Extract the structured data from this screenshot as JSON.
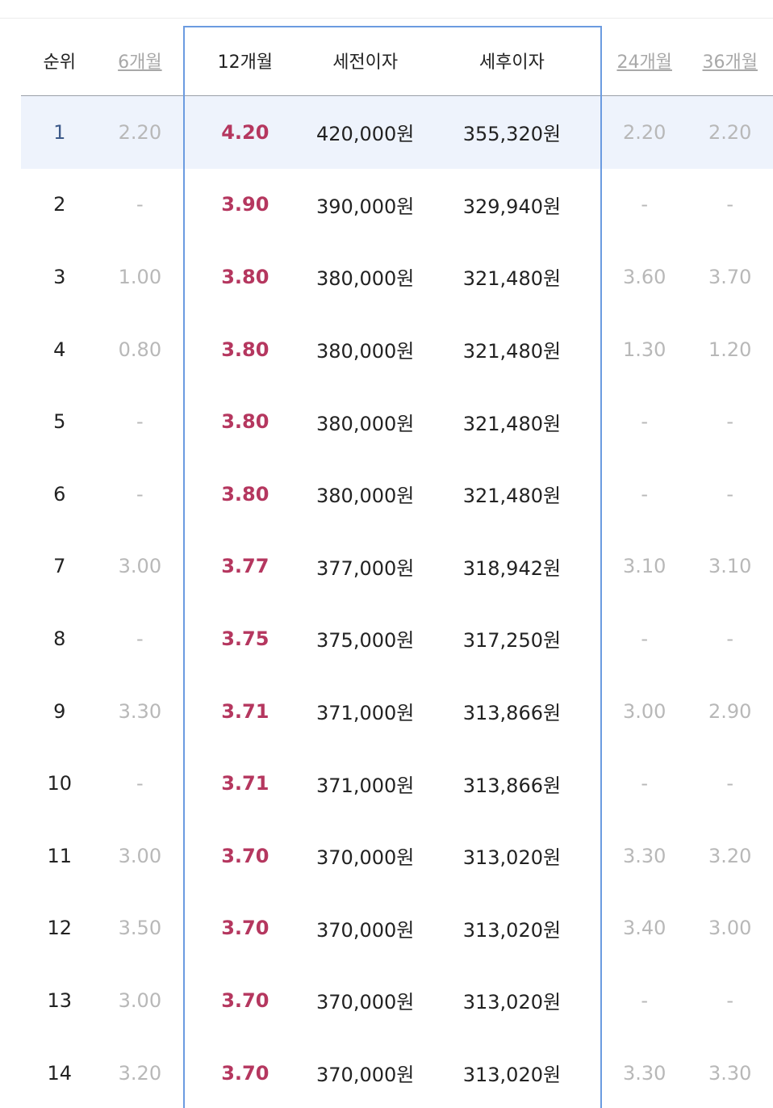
{
  "table": {
    "headers": {
      "rank": "순위",
      "m6": "6개월",
      "m12": "12개월",
      "pre_tax": "세전이자",
      "post_tax": "세후이자",
      "m24": "24개월",
      "m36": "36개월"
    },
    "highlight_color": "#eef3fc",
    "accent_color": "#b5375f",
    "selected_border_color": "#6b9be0",
    "rows": [
      {
        "rank": "1",
        "m6": "2.20",
        "m12": "4.20",
        "pre": "420,000원",
        "post": "355,320원",
        "m24": "2.20",
        "m36": "2.20"
      },
      {
        "rank": "2",
        "m6": "-",
        "m12": "3.90",
        "pre": "390,000원",
        "post": "329,940원",
        "m24": "-",
        "m36": "-"
      },
      {
        "rank": "3",
        "m6": "1.00",
        "m12": "3.80",
        "pre": "380,000원",
        "post": "321,480원",
        "m24": "3.60",
        "m36": "3.70"
      },
      {
        "rank": "4",
        "m6": "0.80",
        "m12": "3.80",
        "pre": "380,000원",
        "post": "321,480원",
        "m24": "1.30",
        "m36": "1.20"
      },
      {
        "rank": "5",
        "m6": "-",
        "m12": "3.80",
        "pre": "380,000원",
        "post": "321,480원",
        "m24": "-",
        "m36": "-"
      },
      {
        "rank": "6",
        "m6": "-",
        "m12": "3.80",
        "pre": "380,000원",
        "post": "321,480원",
        "m24": "-",
        "m36": "-"
      },
      {
        "rank": "7",
        "m6": "3.00",
        "m12": "3.77",
        "pre": "377,000원",
        "post": "318,942원",
        "m24": "3.10",
        "m36": "3.10"
      },
      {
        "rank": "8",
        "m6": "-",
        "m12": "3.75",
        "pre": "375,000원",
        "post": "317,250원",
        "m24": "-",
        "m36": "-"
      },
      {
        "rank": "9",
        "m6": "3.30",
        "m12": "3.71",
        "pre": "371,000원",
        "post": "313,866원",
        "m24": "3.00",
        "m36": "2.90"
      },
      {
        "rank": "10",
        "m6": "-",
        "m12": "3.71",
        "pre": "371,000원",
        "post": "313,866원",
        "m24": "-",
        "m36": "-"
      },
      {
        "rank": "11",
        "m6": "3.00",
        "m12": "3.70",
        "pre": "370,000원",
        "post": "313,020원",
        "m24": "3.30",
        "m36": "3.20"
      },
      {
        "rank": "12",
        "m6": "3.50",
        "m12": "3.70",
        "pre": "370,000원",
        "post": "313,020원",
        "m24": "3.40",
        "m36": "3.00"
      },
      {
        "rank": "13",
        "m6": "3.00",
        "m12": "3.70",
        "pre": "370,000원",
        "post": "313,020원",
        "m24": "-",
        "m36": "-"
      },
      {
        "rank": "14",
        "m6": "3.20",
        "m12": "3.70",
        "pre": "370,000원",
        "post": "313,020원",
        "m24": "3.30",
        "m36": "3.30"
      }
    ]
  }
}
